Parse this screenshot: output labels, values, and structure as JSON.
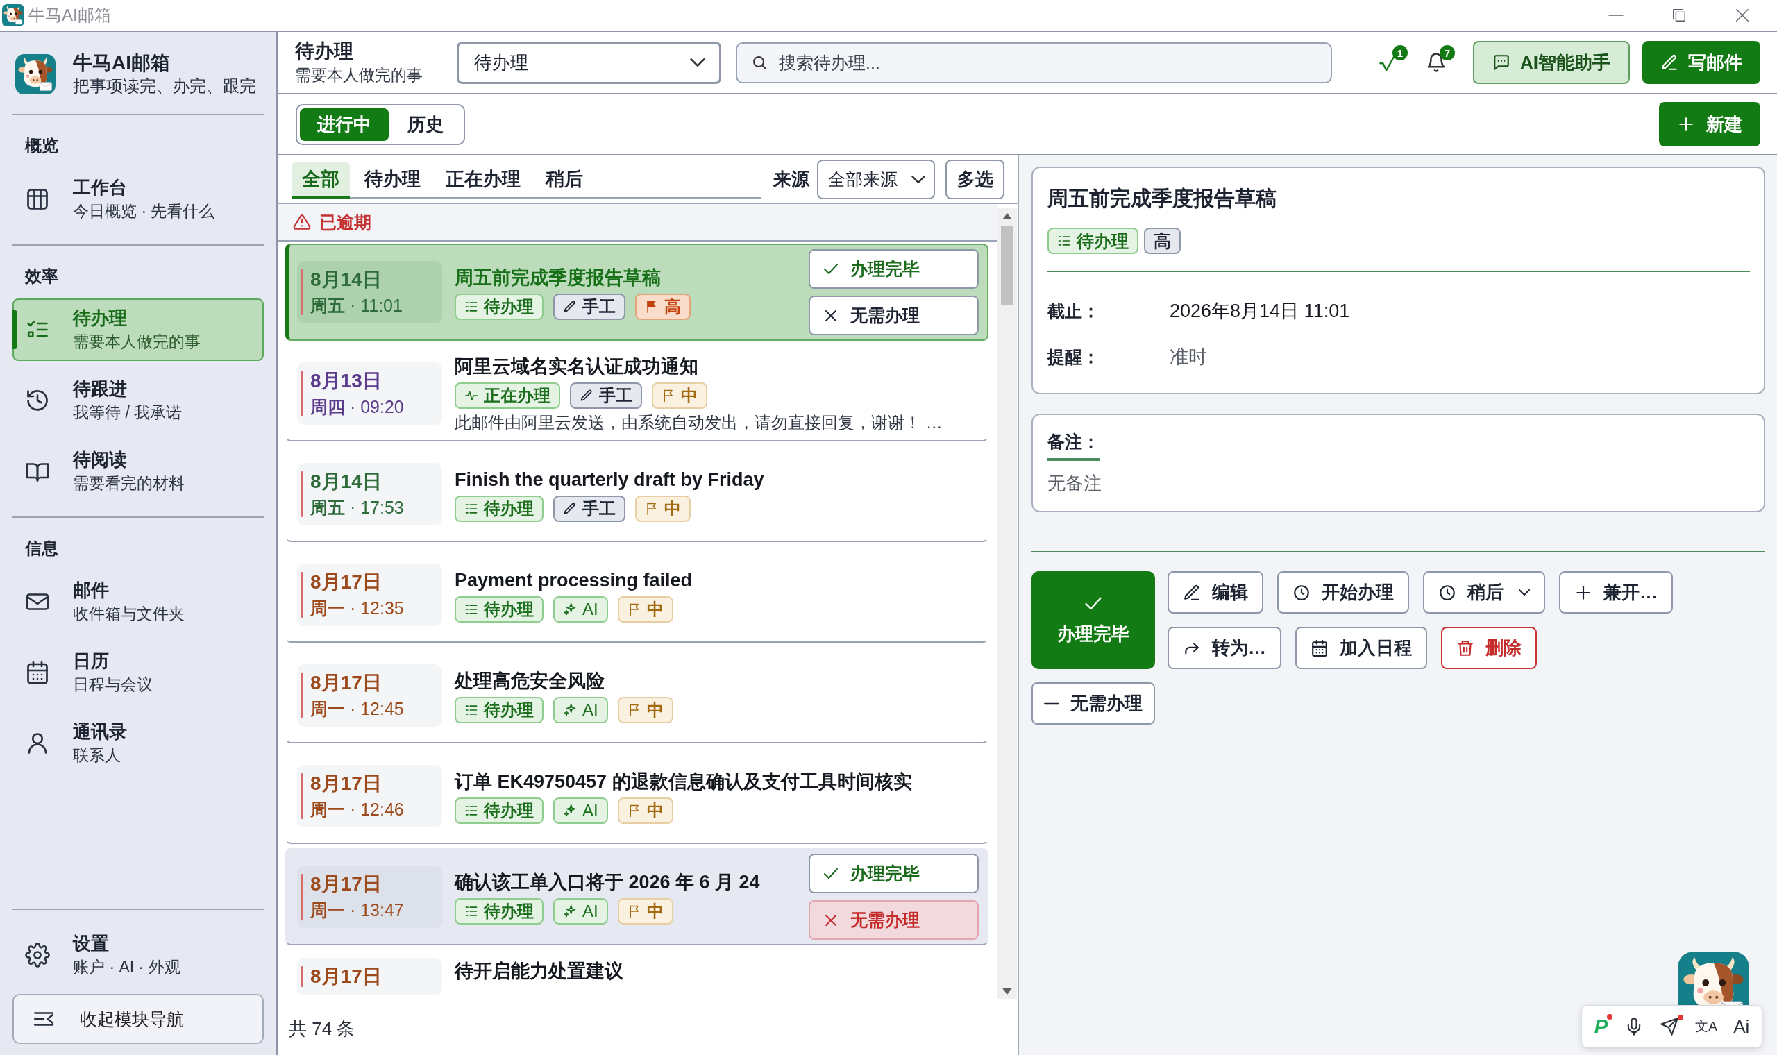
{
  "window": {
    "title": "牛马AI邮箱"
  },
  "sidebar": {
    "app_name": "牛马AI邮箱",
    "tagline": "把事项读完、办完、跟完",
    "sections": [
      {
        "label": "概览",
        "items": [
          {
            "kind": "dashboard",
            "title": "工作台",
            "subtitle": "今日概览 · 先看什么",
            "selected": false
          }
        ]
      },
      {
        "label": "效率",
        "items": [
          {
            "kind": "todo",
            "title": "待办理",
            "subtitle": "需要本人做完的事",
            "selected": true
          },
          {
            "kind": "followup",
            "title": "待跟进",
            "subtitle": "我等待 / 我承诺",
            "selected": false
          },
          {
            "kind": "reading",
            "title": "待阅读",
            "subtitle": "需要看完的材料",
            "selected": false
          }
        ]
      },
      {
        "label": "信息",
        "items": [
          {
            "kind": "mail",
            "title": "邮件",
            "subtitle": "收件箱与文件夹",
            "selected": false
          },
          {
            "kind": "calendar",
            "title": "日历",
            "subtitle": "日程与会议",
            "selected": false
          },
          {
            "kind": "contacts",
            "title": "通讯录",
            "subtitle": "联系人",
            "selected": false
          }
        ]
      }
    ],
    "footer_items": [
      {
        "kind": "settings",
        "title": "设置",
        "subtitle": "账户 · AI · 外观",
        "selected": false
      }
    ],
    "collapse_button": "收起模块导航"
  },
  "header": {
    "title": "待办理",
    "subtitle": "需要本人做完的事",
    "view_select": {
      "value": "待办理"
    },
    "search": {
      "placeholder": "搜索待办理..."
    },
    "indicators": [
      {
        "kind": "tasks",
        "count": "1"
      },
      {
        "kind": "bell",
        "count": "7"
      }
    ],
    "ai_button": "AI智能助手",
    "compose_button": "写邮件"
  },
  "toolbar": {
    "segments": [
      {
        "label": "进行中",
        "selected": true
      },
      {
        "label": "历史",
        "selected": false
      }
    ],
    "new_button": "新建"
  },
  "list": {
    "filters": [
      {
        "label": "全部",
        "selected": true
      },
      {
        "label": "待办理",
        "selected": false
      },
      {
        "label": "正在办理",
        "selected": false
      },
      {
        "label": "稍后",
        "selected": false
      }
    ],
    "source": {
      "label": "来源",
      "value": "全部来源"
    },
    "multi_select_button": "多选",
    "group": "已逾期",
    "items": [
      {
        "date": "8月14日",
        "time": "**周五** · 11:01",
        "color": "#2e6b3a",
        "title": "周五前完成季度报告草稿",
        "tags": [
          {
            "kind": "todo",
            "label": "待办理"
          },
          {
            "kind": "manual",
            "label": "手工"
          },
          {
            "kind": "high",
            "label": "高"
          }
        ],
        "selected": true,
        "hovered": false,
        "actions": [
          {
            "kind": "done",
            "label": "办理完毕",
            "hovered": false
          },
          {
            "kind": "dismiss",
            "label": "无需办理",
            "hovered": false
          }
        ]
      },
      {
        "date": "8月13日",
        "time": "**周四** · 09:20",
        "color": "#5b3b8c",
        "title": "阿里云域名实名认证成功通知",
        "tags": [
          {
            "kind": "in_progress",
            "label": "正在办理"
          },
          {
            "kind": "manual",
            "label": "手工"
          },
          {
            "kind": "medium",
            "label": "中"
          }
        ],
        "snippet": "此邮件由阿里云发送，由系统自动发出，请勿直接回复，谢谢！ …",
        "selected": false,
        "hovered": false
      },
      {
        "date": "8月14日",
        "time": "**周五** · 17:53",
        "color": "#2e6b3a",
        "title": "Finish the quarterly draft by Friday",
        "tags": [
          {
            "kind": "todo",
            "label": "待办理"
          },
          {
            "kind": "manual",
            "label": "手工"
          },
          {
            "kind": "medium",
            "label": "中"
          }
        ],
        "selected": false,
        "hovered": false
      },
      {
        "date": "8月17日",
        "time": "**周一** · 12:35",
        "color": "#9c4a1c",
        "title": "Payment processing failed",
        "tags": [
          {
            "kind": "todo",
            "label": "待办理"
          },
          {
            "kind": "ai",
            "label": "AI"
          },
          {
            "kind": "medium",
            "label": "中"
          }
        ],
        "selected": false,
        "hovered": false
      },
      {
        "date": "8月17日",
        "time": "**周一** · 12:45",
        "color": "#9c4a1c",
        "title": "处理高危安全风险",
        "tags": [
          {
            "kind": "todo",
            "label": "待办理"
          },
          {
            "kind": "ai",
            "label": "AI"
          },
          {
            "kind": "medium",
            "label": "中"
          }
        ],
        "selected": false,
        "hovered": false
      },
      {
        "date": "8月17日",
        "time": "**周一** · 12:46",
        "color": "#9c4a1c",
        "title": "订单 EK49750457 的退款信息确认及支付工具时间核实",
        "tags": [
          {
            "kind": "todo",
            "label": "待办理"
          },
          {
            "kind": "ai",
            "label": "AI"
          },
          {
            "kind": "medium",
            "label": "中"
          }
        ],
        "selected": false,
        "hovered": false
      },
      {
        "date": "8月17日",
        "time": "**周一** · 13:47",
        "color": "#9c4a1c",
        "title": "确认该工单入口将于 2026 年 6 月 24",
        "tags": [
          {
            "kind": "todo",
            "label": "待办理"
          },
          {
            "kind": "ai",
            "label": "AI"
          },
          {
            "kind": "medium",
            "label": "中"
          }
        ],
        "selected": false,
        "hovered": true,
        "actions": [
          {
            "kind": "done",
            "label": "办理完毕",
            "hovered": false
          },
          {
            "kind": "dismiss",
            "label": "无需办理",
            "hovered": true
          }
        ]
      },
      {
        "date": "8月17日",
        "color": "#9c4a1c",
        "title": "待开启能力处置建议",
        "selected": false,
        "hovered": false
      }
    ],
    "total": "共 74 条"
  },
  "detail": {
    "title": "周五前完成季度报告草稿",
    "tags": [
      {
        "kind": "todo",
        "label": "待办理"
      },
      {
        "kind": "plain",
        "label": "高"
      }
    ],
    "fields": [
      {
        "label": "截止：",
        "value": "2026年8月14日 11:01",
        "muted": false
      },
      {
        "label": "提醒：",
        "value": "准时",
        "muted": true
      }
    ],
    "notes": {
      "label": "备注：",
      "value": "无备注"
    },
    "actions": [
      {
        "kind": "complete",
        "label": "办理完毕"
      },
      {
        "kind": "edit",
        "label": "编辑"
      },
      {
        "kind": "start",
        "label": "开始办理"
      },
      {
        "kind": "later",
        "label": "稍后"
      },
      {
        "kind": "parallel",
        "label": "兼开…"
      },
      {
        "kind": "convert",
        "label": "转为…"
      },
      {
        "kind": "schedule",
        "label": "加入日程"
      },
      {
        "kind": "delete",
        "label": "删除"
      },
      {
        "kind": "dismiss",
        "label": "无需办理"
      }
    ]
  },
  "assistant_bar": {
    "items": [
      {
        "kind": "plugin",
        "label": "P",
        "dot": true
      },
      {
        "kind": "mic",
        "dot": false
      },
      {
        "kind": "send",
        "dot": true
      },
      {
        "kind": "translate",
        "label": "文A",
        "dot": false
      },
      {
        "kind": "ai",
        "label": "Ai",
        "dot": false
      }
    ]
  }
}
